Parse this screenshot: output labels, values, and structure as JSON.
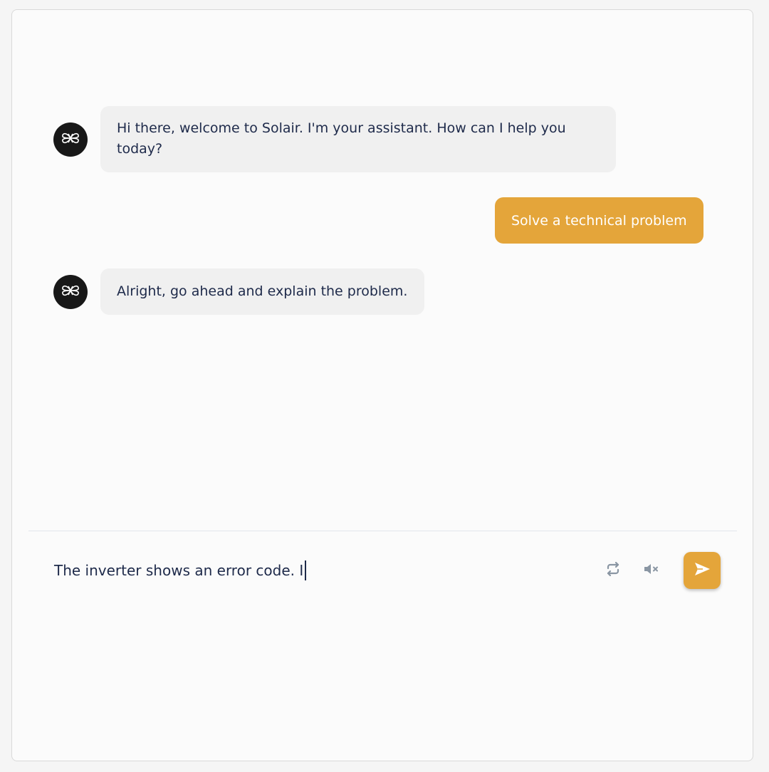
{
  "colors": {
    "accent": "#e4a53a",
    "bot_bubble": "#f0f0f0",
    "text": "#1e2a4a",
    "avatar": "#181818",
    "icon": "#8a96a3"
  },
  "chat": {
    "messages": [
      {
        "role": "assistant",
        "avatar_icon": "solair-logo-icon",
        "text": "Hi there, welcome to Solair. I'm your assistant. How can I help you today?"
      },
      {
        "role": "user",
        "text": "Solve a technical problem"
      },
      {
        "role": "assistant",
        "avatar_icon": "solair-logo-icon",
        "text": "Alright, go ahead and explain the problem."
      }
    ]
  },
  "composer": {
    "value": "The inverter shows an error code. I"
  },
  "toolbar": {
    "refresh_icon": "refresh-icon",
    "mute_icon": "volume-muted-icon",
    "send_icon": "send-icon"
  }
}
